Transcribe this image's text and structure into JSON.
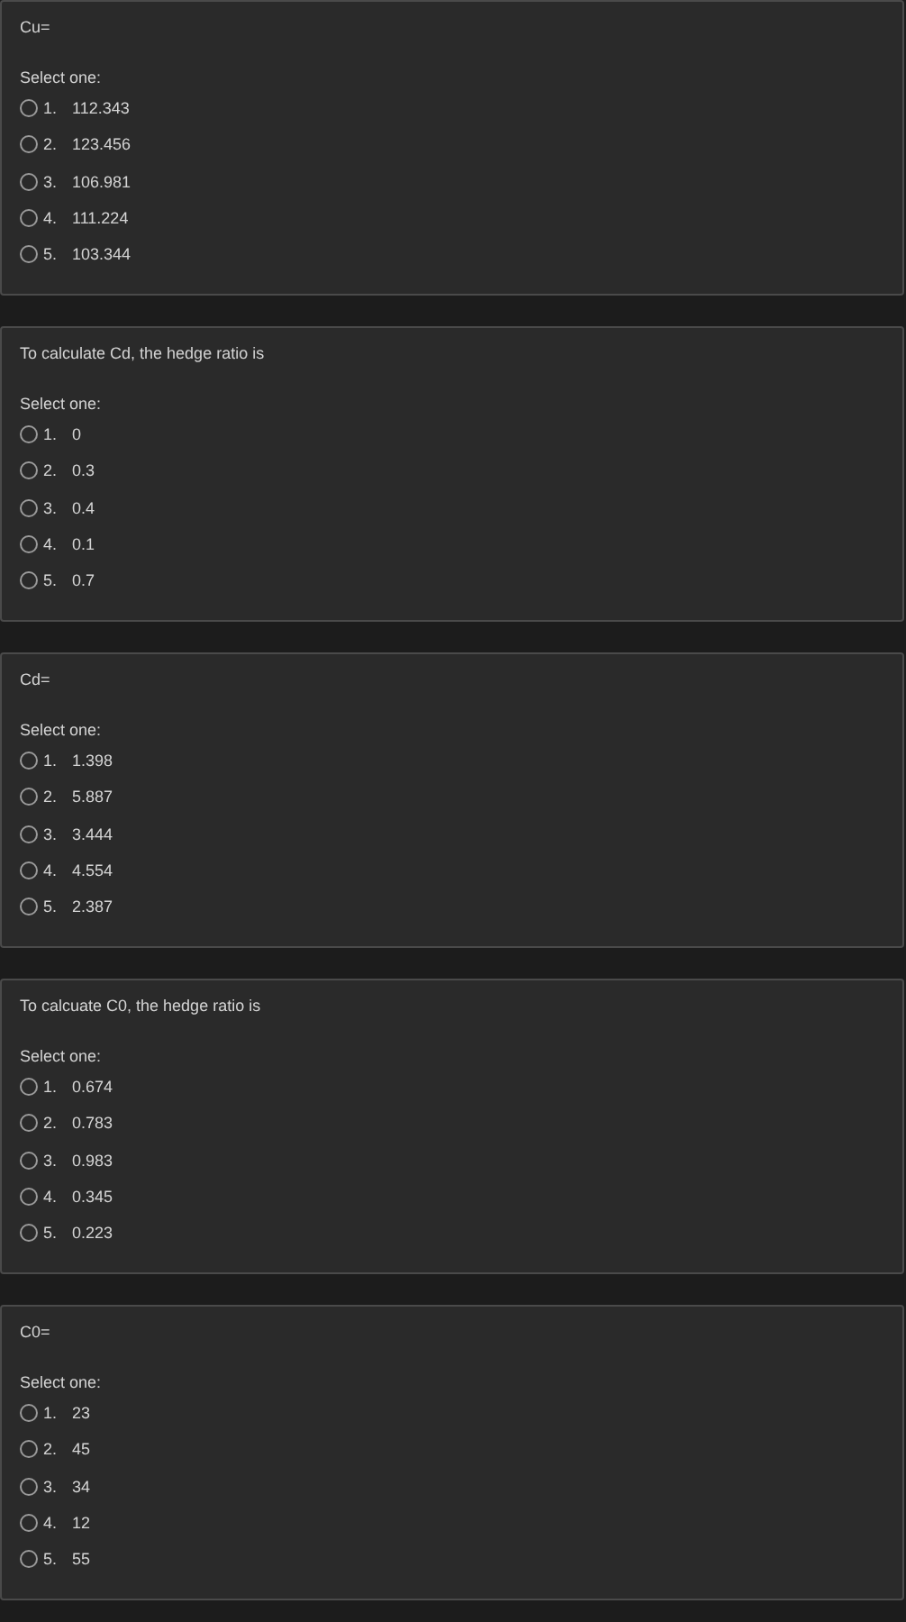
{
  "questions": [
    {
      "prompt": "Cu=",
      "instruction": "Select one:",
      "options": [
        {
          "number": "1.",
          "text": "112.343",
          "selected": false
        },
        {
          "number": "2.",
          "text": "123.456",
          "selected": false
        },
        {
          "number": "3.",
          "text": "106.981",
          "selected": false
        },
        {
          "number": "4.",
          "text": "111.224",
          "selected": false
        },
        {
          "number": "5.",
          "text": "103.344",
          "selected": false
        }
      ]
    },
    {
      "prompt": "To calculate Cd, the hedge ratio is",
      "instruction": "Select one:",
      "options": [
        {
          "number": "1.",
          "text": "0",
          "selected": false
        },
        {
          "number": "2.",
          "text": "0.3",
          "selected": false
        },
        {
          "number": "3.",
          "text": "0.4",
          "selected": false
        },
        {
          "number": "4.",
          "text": "0.1",
          "selected": false
        },
        {
          "number": "5.",
          "text": "0.7",
          "selected": false
        }
      ]
    },
    {
      "prompt": "Cd=",
      "instruction": "Select one:",
      "options": [
        {
          "number": "1.",
          "text": "1.398",
          "selected": false
        },
        {
          "number": "2.",
          "text": "5.887",
          "selected": false
        },
        {
          "number": "3.",
          "text": "3.444",
          "selected": false
        },
        {
          "number": "4.",
          "text": "4.554",
          "selected": false
        },
        {
          "number": "5.",
          "text": "2.387",
          "selected": false
        }
      ]
    },
    {
      "prompt": "To calcuate C0, the hedge ratio is",
      "instruction": "Select one:",
      "options": [
        {
          "number": "1.",
          "text": "0.674",
          "selected": false
        },
        {
          "number": "2.",
          "text": "0.783",
          "selected": false
        },
        {
          "number": "3.",
          "text": "0.983",
          "selected": false
        },
        {
          "number": "4.",
          "text": "0.345",
          "selected": false
        },
        {
          "number": "5.",
          "text": "0.223",
          "selected": false
        }
      ]
    },
    {
      "prompt": "C0=",
      "instruction": "Select one:",
      "options": [
        {
          "number": "1.",
          "text": "23",
          "selected": false
        },
        {
          "number": "2.",
          "text": "45",
          "selected": false
        },
        {
          "number": "3.",
          "text": "34",
          "selected": false
        },
        {
          "number": "4.",
          "text": "12",
          "selected": false
        },
        {
          "number": "5.",
          "text": "55",
          "selected": false
        }
      ]
    }
  ]
}
